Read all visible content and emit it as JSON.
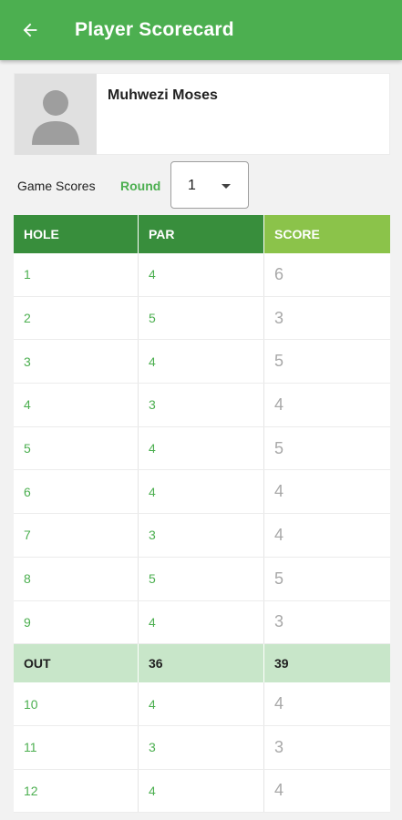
{
  "appbar": {
    "title": "Player Scorecard",
    "back_icon": "arrow-left-icon"
  },
  "player": {
    "name": "Muhwezi Moses",
    "avatar_icon": "person-placeholder-icon"
  },
  "scores": {
    "label": "Game Scores",
    "round_label": "Round",
    "round_value": "1"
  },
  "table": {
    "headers": {
      "hole": "HOLE",
      "par": "PAR",
      "score": "SCORE"
    },
    "front_nine": [
      {
        "hole": "1",
        "par": "4",
        "score": "6"
      },
      {
        "hole": "2",
        "par": "5",
        "score": "3"
      },
      {
        "hole": "3",
        "par": "4",
        "score": "5"
      },
      {
        "hole": "4",
        "par": "3",
        "score": "4"
      },
      {
        "hole": "5",
        "par": "4",
        "score": "5"
      },
      {
        "hole": "6",
        "par": "4",
        "score": "4"
      },
      {
        "hole": "7",
        "par": "3",
        "score": "4"
      },
      {
        "hole": "8",
        "par": "5",
        "score": "5"
      },
      {
        "hole": "9",
        "par": "4",
        "score": "3"
      }
    ],
    "out": {
      "label": "OUT",
      "par": "36",
      "score": "39"
    },
    "back_nine": [
      {
        "hole": "10",
        "par": "4",
        "score": "4"
      },
      {
        "hole": "11",
        "par": "3",
        "score": "3"
      },
      {
        "hole": "12",
        "par": "4",
        "score": "4"
      }
    ]
  },
  "colors": {
    "primary": "#4caf50",
    "header_dark": "#388e3c",
    "header_light": "#8bc34a",
    "out_row": "#c8e6c9"
  }
}
